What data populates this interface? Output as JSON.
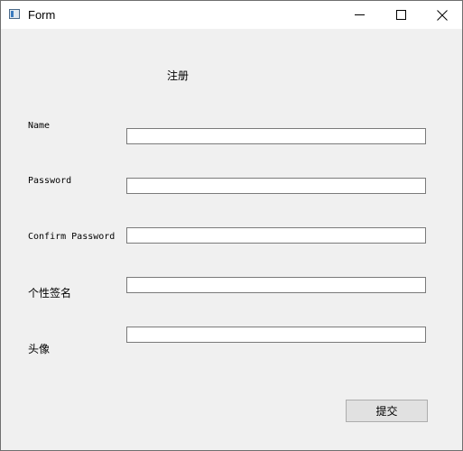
{
  "window": {
    "title": "Form",
    "icon": "app-form-icon",
    "controls": [
      "minimize-icon",
      "maximize-icon",
      "close-icon"
    ]
  },
  "form": {
    "heading": "注册",
    "fields": [
      {
        "label": "Name",
        "value": "",
        "placeholder": ""
      },
      {
        "label": "Password",
        "value": "",
        "placeholder": ""
      },
      {
        "label": "Confirm Password",
        "value": "",
        "placeholder": ""
      },
      {
        "label": "个性签名",
        "value": "",
        "placeholder": ""
      },
      {
        "label": "头像",
        "value": "",
        "placeholder": ""
      }
    ],
    "submit_label": "提交"
  }
}
